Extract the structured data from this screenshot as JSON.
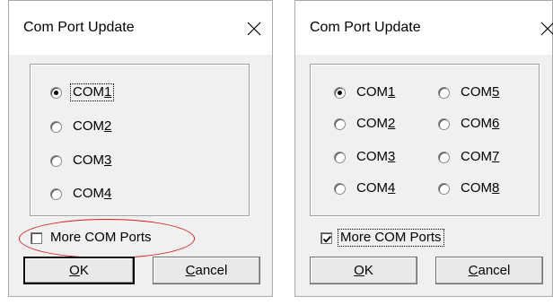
{
  "dialog_left": {
    "title": "Com Port Update",
    "radios": [
      {
        "label": "COM1",
        "accel_prefix": "COM",
        "accel": "1",
        "checked": true,
        "focused": true
      },
      {
        "label": "COM2",
        "accel_prefix": "COM",
        "accel": "2",
        "checked": false
      },
      {
        "label": "COM3",
        "accel_prefix": "COM",
        "accel": "3",
        "checked": false
      },
      {
        "label": "COM4",
        "accel_prefix": "COM",
        "accel": "4",
        "checked": false
      }
    ],
    "more_ports": {
      "label": "More COM Ports",
      "checked": false
    },
    "ok": {
      "accel": "O",
      "rest": "K"
    },
    "cancel": {
      "accel": "C",
      "rest": "ancel"
    },
    "highlight_color": "#d41f1f"
  },
  "dialog_right": {
    "title": "Com Port Update",
    "radios": [
      {
        "label": "COM1",
        "accel_prefix": "COM",
        "accel": "1",
        "checked": true
      },
      {
        "label": "COM2",
        "accel_prefix": "COM",
        "accel": "2",
        "checked": false
      },
      {
        "label": "COM3",
        "accel_prefix": "COM",
        "accel": "3",
        "checked": false
      },
      {
        "label": "COM4",
        "accel_prefix": "COM",
        "accel": "4",
        "checked": false
      },
      {
        "label": "COM5",
        "accel_prefix": "COM",
        "accel": "5",
        "checked": false
      },
      {
        "label": "COM6",
        "accel_prefix": "COM",
        "accel": "6",
        "checked": false
      },
      {
        "label": "COM7",
        "accel_prefix": "COM",
        "accel": "7",
        "checked": false
      },
      {
        "label": "COM8",
        "accel_prefix": "COM",
        "accel": "8",
        "checked": false
      }
    ],
    "more_ports": {
      "label": "More COM Ports",
      "checked": true,
      "focused": true
    },
    "ok": {
      "accel": "O",
      "rest": "K"
    },
    "cancel": {
      "accel": "C",
      "rest": "ancel"
    }
  },
  "icons": {
    "close": "close-icon",
    "check": "checkmark-icon"
  },
  "colors": {
    "dialog_bg": "#f0f0f0",
    "title_bg": "#ffffff",
    "highlight": "#d41f1f"
  }
}
